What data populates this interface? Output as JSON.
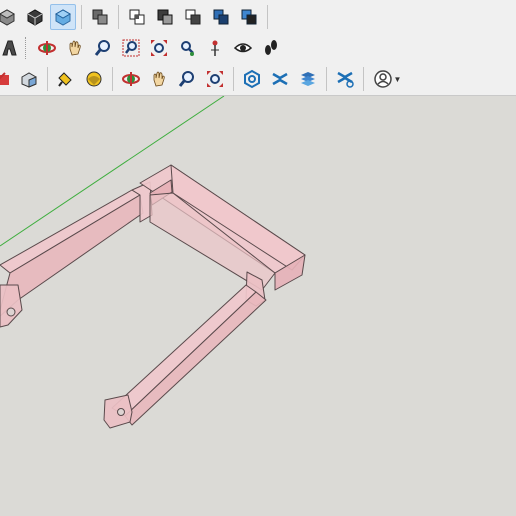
{
  "toolbar": {
    "row1": [
      "shaded-style-icon",
      "monochrome-style-icon",
      "xray-style-icon",
      "union-icon",
      "intersect-icon",
      "subtract-icon",
      "trim-icon",
      "split-icon",
      "outer-shell-icon"
    ],
    "row2": [
      "text-3d-icon",
      "orbit-icon",
      "pan-icon",
      "zoom-icon",
      "zoom-window-icon",
      "zoom-extents-icon",
      "position-camera-icon",
      "look-around-icon",
      "walk-icon"
    ],
    "row3": [
      "move-icon",
      "push-pull-icon",
      "paint-bucket-icon",
      "eraser-icon",
      "orbit-icon",
      "pan-icon",
      "zoom-icon",
      "zoom-extents-icon",
      "section-plane-icon",
      "display-section-planes-icon",
      "section-cuts-icon",
      "section-fill-icon",
      "account-icon"
    ],
    "active": "xray-style-icon"
  },
  "colors": {
    "toolbar_bg": "#f0f0f0",
    "viewport_bg": "#dbdad6",
    "model_fill": "#f0c8cc",
    "model_edge": "#5a4a4c",
    "green_axis": "#3fae3f"
  }
}
